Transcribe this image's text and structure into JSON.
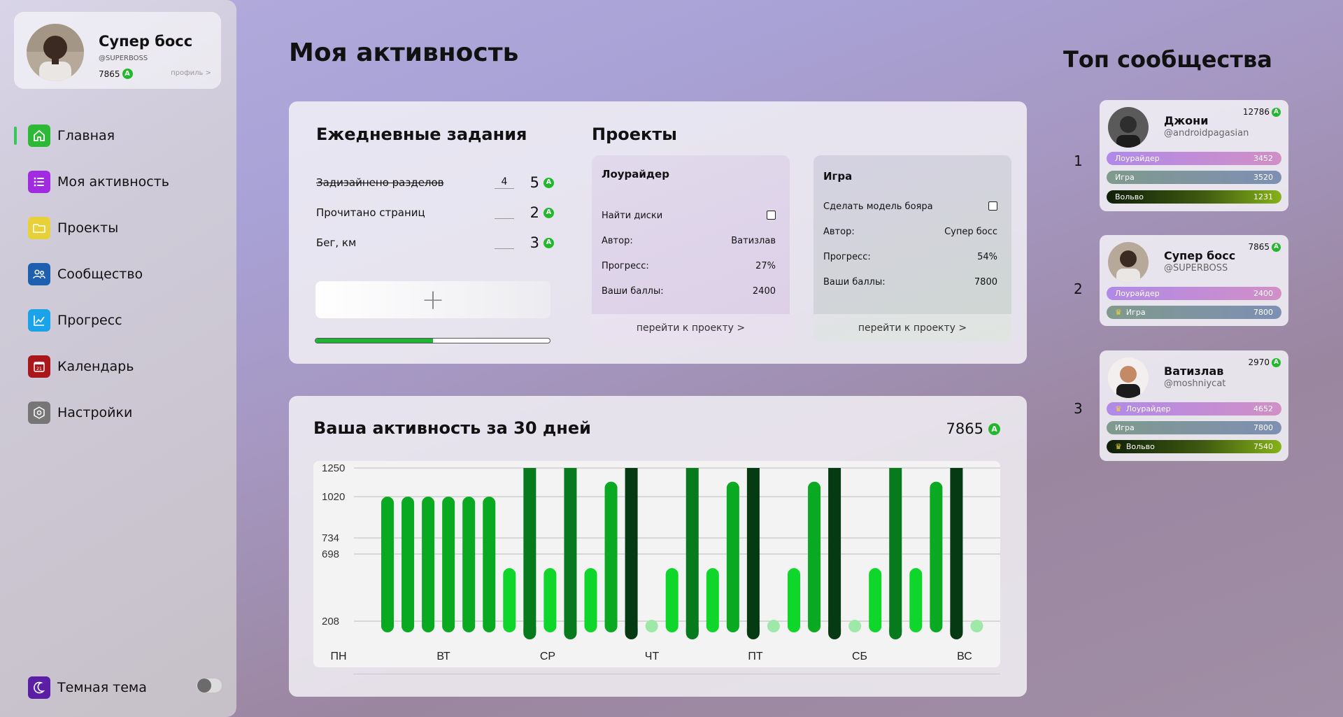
{
  "profile": {
    "name": "Супер босс",
    "handle": "@SUPERBOSS",
    "points": "7865",
    "profile_link": "профиль >"
  },
  "coin_letter": "A",
  "nav": [
    {
      "label": "Главная",
      "icon": "home-icon",
      "color": "#2db937"
    },
    {
      "label": "Моя активность",
      "icon": "list-icon",
      "color": "#a12be0"
    },
    {
      "label": "Проекты",
      "icon": "folder-icon",
      "color": "#e8d138"
    },
    {
      "label": "Сообщество",
      "icon": "people-icon",
      "color": "#1f5fb0"
    },
    {
      "label": "Прогресс",
      "icon": "chart-icon",
      "color": "#1aa3e8"
    },
    {
      "label": "Календарь",
      "icon": "calendar-icon",
      "color": "#a9171c"
    },
    {
      "label": "Настройки",
      "icon": "settings-icon",
      "color": "#767676"
    }
  ],
  "dark_theme": {
    "label": "Темная тема",
    "enabled": false,
    "color": "#5b1fa6"
  },
  "page_title": "Моя активность",
  "daily": {
    "title": "Ежедневные задания",
    "tasks": [
      {
        "name": "Задизайнено   разделов",
        "input": "4",
        "value": "5",
        "done": true
      },
      {
        "name": "Прочитано страниц",
        "input": "",
        "value": "2",
        "done": false
      },
      {
        "name": "Бег, км",
        "input": "",
        "value": "3",
        "done": false
      }
    ],
    "add_label": "+",
    "progress": 0.5
  },
  "projects": {
    "title": "Проекты",
    "items": [
      {
        "name": "Лоурайдер",
        "task": "Найти диски",
        "author_label": "Автор:",
        "author": "Ватизлав",
        "progress_label": "Прогресс:",
        "progress": "27%",
        "points_label": "Ваши баллы:",
        "points": "2400",
        "link": "перейти к проекту  >"
      },
      {
        "name": "Игра",
        "task": "Сделать модель бояра",
        "author_label": "Автор:",
        "author": "Супер босс",
        "progress_label": "Прогресс:",
        "progress": "54%",
        "points_label": "Ваши баллы:",
        "points": "7800",
        "link": "перейти к проекту  >"
      }
    ]
  },
  "activity": {
    "title": "Ваша активность за 30 дней",
    "total": "7865"
  },
  "chart_data": {
    "type": "bar",
    "y_ticks": [
      "1250",
      "1020",
      "734",
      "698",
      "208"
    ],
    "y_tick_values": [
      1250,
      1020,
      734,
      698,
      208
    ],
    "ylim": [
      100,
      1250
    ],
    "x_labels": [
      "ПН",
      "ВТ",
      "СР",
      "ЧТ",
      "ПТ",
      "СБ",
      "ВС"
    ],
    "values": [
      1020,
      1020,
      1020,
      1020,
      1020,
      1020,
      595,
      1250,
      595,
      1250,
      595,
      1140,
      1250,
      120,
      595,
      1250,
      595,
      1140,
      1250,
      120,
      595,
      1140,
      1250,
      120,
      595,
      1250,
      595,
      1140,
      1250,
      120
    ],
    "levels": [
      2,
      2,
      2,
      2,
      2,
      2,
      1,
      3,
      1,
      3,
      1,
      2,
      4,
      0,
      1,
      3,
      1,
      2,
      4,
      0,
      1,
      2,
      4,
      0,
      1,
      3,
      1,
      2,
      4,
      0
    ],
    "level_colors": [
      "#9ee8a8",
      "#0fd62a",
      "#0aa922",
      "#077a1d",
      "#053a12"
    ],
    "grid": true
  },
  "community": {
    "title": "Топ сообщества",
    "members": [
      {
        "rank": "1",
        "name": "Джони",
        "handle": "@androidpagasian",
        "points": "12786",
        "projects": [
          {
            "label": "Лоурайдер",
            "value": "3452",
            "kind": "lowrider",
            "crown": false
          },
          {
            "label": "Игра",
            "value": "3520",
            "kind": "game",
            "crown": false
          },
          {
            "label": "Вольво",
            "value": "1231",
            "kind": "volvo",
            "crown": false
          }
        ]
      },
      {
        "rank": "2",
        "name": "Супер босс",
        "handle": "@SUPERBOSS",
        "points": "7865",
        "projects": [
          {
            "label": "Лоурайдер",
            "value": "2400",
            "kind": "lowrider",
            "crown": false
          },
          {
            "label": "Игра",
            "value": "7800",
            "kind": "game",
            "crown": true
          }
        ]
      },
      {
        "rank": "3",
        "name": "Ватизлав",
        "handle": "@moshniycat",
        "points": "2970",
        "projects": [
          {
            "label": "Лоурайдер",
            "value": "4652",
            "kind": "lowrider",
            "crown": true
          },
          {
            "label": "Игра",
            "value": "7800",
            "kind": "game",
            "crown": false
          },
          {
            "label": "Вольво",
            "value": "7540",
            "kind": "volvo",
            "crown": true
          }
        ]
      }
    ]
  }
}
